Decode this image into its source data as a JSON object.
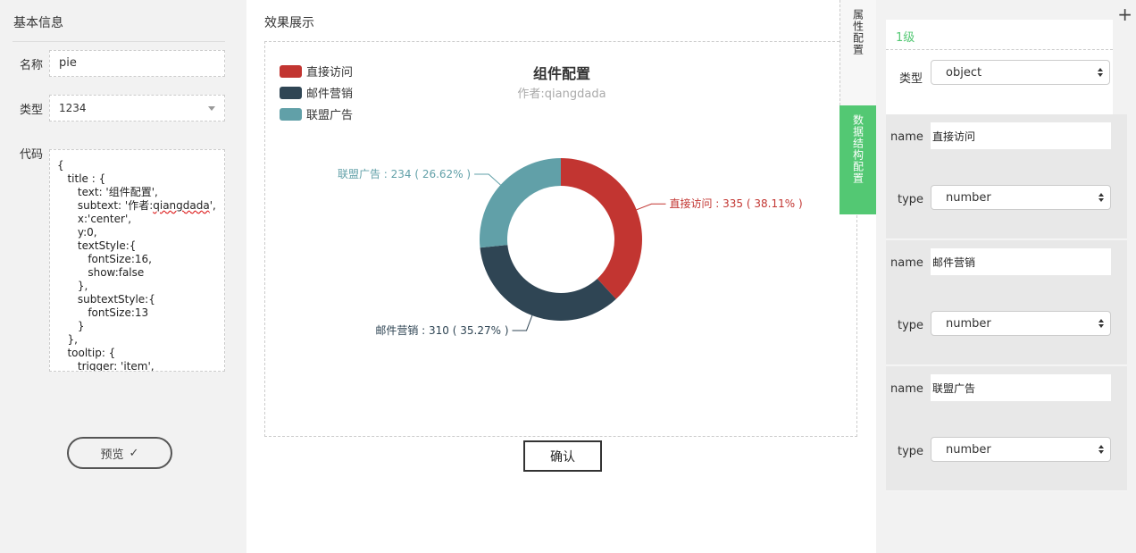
{
  "left": {
    "title": "基本信息",
    "name_label": "名称",
    "name_value": "pie",
    "type_label": "类型",
    "type_value": "1234",
    "code_label": "代码",
    "code_lines": [
      "{",
      "   title : {",
      "      text: '组件配置',",
      "      subtext: '作者:qiangdada',",
      "      x:'center',",
      "      y:0,",
      "      textStyle:{",
      "         fontSize:16,",
      "         show:false",
      "      },",
      "      subtextStyle:{",
      "         fontSize:13",
      "      }",
      "   },",
      "   tooltip: {",
      "      trigger: 'item',"
    ],
    "preview_label": "预览",
    "preview_icon": "✓"
  },
  "middle": {
    "title": "效果展示",
    "confirm_label": "确认"
  },
  "tabs": {
    "attr_label": "属性配置",
    "data_label": "数据结构配置"
  },
  "right": {
    "level_title": "1级",
    "type_label": "类型",
    "type_value": "object",
    "fields": [
      {
        "name_label": "name",
        "name_value": "直接访问",
        "type_label": "type",
        "type_value": "number"
      },
      {
        "name_label": "name",
        "name_value": "邮件营销",
        "type_label": "type",
        "type_value": "number"
      },
      {
        "name_label": "name",
        "name_value": "联盟广告",
        "type_label": "type",
        "type_value": "number"
      }
    ]
  },
  "chart_data": {
    "type": "pie",
    "title": "组件配置",
    "subtitle": "作者:qiangdada",
    "legend_position": "top-left",
    "categories": [
      "直接访问",
      "邮件营销",
      "联盟广告"
    ],
    "values": [
      335,
      310,
      234
    ],
    "colors": [
      "#c23531",
      "#2f4554",
      "#61a0a8"
    ],
    "data_labels": [
      "直接访问 : 335 ( 38.11% )",
      "邮件营销 : 310 ( 35.27% )",
      "联盟广告 : 234 ( 26.62% )"
    ]
  }
}
